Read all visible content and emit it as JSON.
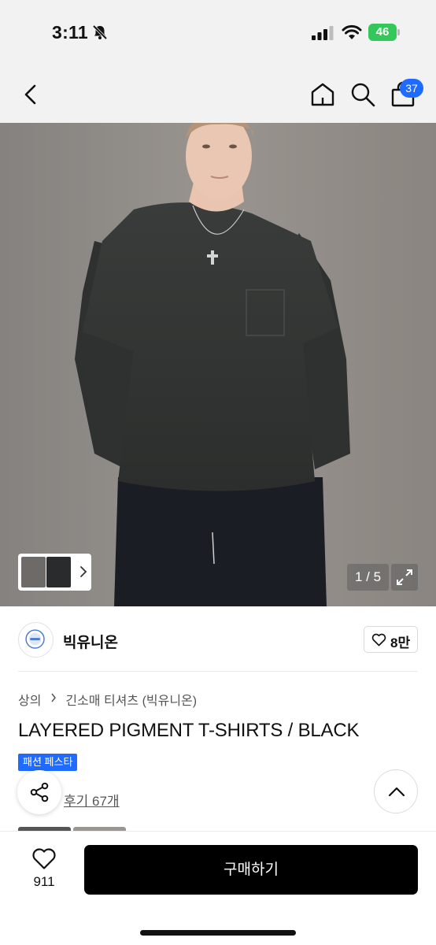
{
  "status_bar": {
    "time": "3:11",
    "battery_level": "46"
  },
  "nav": {
    "cart_count": "37"
  },
  "gallery": {
    "current_page": "1 / 5"
  },
  "brand": {
    "name": "빅유니온",
    "like_count": "8만"
  },
  "breadcrumb": {
    "category": "상의",
    "subcategory": "긴소매 티셔츠 (빅유니온)"
  },
  "product": {
    "title": "LAYERED PIGMENT T-SHIRTS / BLACK",
    "promo_badge": "패션 페스타",
    "review_link": "후기 67개"
  },
  "bottom_bar": {
    "wish_count": "911",
    "buy_label": "구매하기"
  },
  "colors": {
    "accent": "#1f6bff",
    "battery": "#34c759",
    "buy_button": "#000000"
  },
  "icons": [
    "bell-slash-icon",
    "signal-icon",
    "wifi-icon",
    "back-icon",
    "home-icon",
    "search-icon",
    "shopping-bag-icon",
    "chevron-right-icon",
    "expand-icon",
    "heart-icon",
    "share-icon",
    "chevron-up-icon"
  ]
}
